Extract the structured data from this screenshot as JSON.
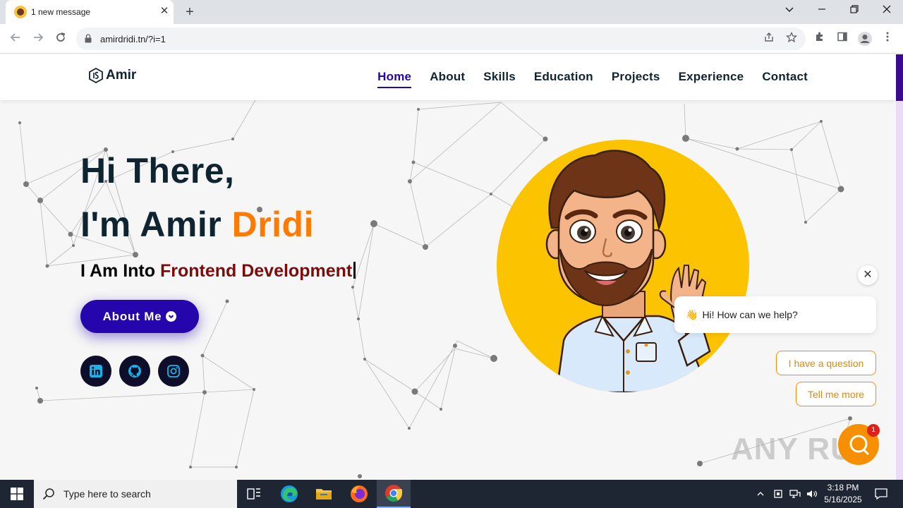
{
  "browser": {
    "tab_title": "1 new message",
    "url": "amirdridi.tn/?i=1",
    "tab_close": "✕",
    "new_tab": "+"
  },
  "site": {
    "logo_text": "Amir",
    "nav": [
      {
        "label": "Home",
        "active": true
      },
      {
        "label": "About",
        "active": false
      },
      {
        "label": "Skills",
        "active": false
      },
      {
        "label": "Education",
        "active": false
      },
      {
        "label": "Projects",
        "active": false
      },
      {
        "label": "Experience",
        "active": false
      },
      {
        "label": "Contact",
        "active": false
      }
    ],
    "hero": {
      "line1": "Hi There,",
      "line2_prefix": "I'm Amir ",
      "line2_highlight": "Dridi",
      "subtitle_prefix": "I Am Into ",
      "subtitle_highlight": "Frontend Development",
      "button_label": "About Me"
    },
    "social": [
      "linkedin-icon",
      "github-icon",
      "instagram-icon"
    ],
    "colors": {
      "primary": "#2506ad",
      "heading": "#0e2431",
      "highlight_orange": "#ff7a00",
      "highlight_red": "#7c0b0b",
      "avatar_bg": "#fcc400"
    }
  },
  "chat": {
    "greeting": "Hi! How can we help?",
    "options": [
      "I have a question",
      "Tell me more"
    ],
    "badge_count": "1",
    "close": "✕"
  },
  "watermark": "ANY RUN",
  "taskbar": {
    "search_placeholder": "Type here to search",
    "time": "3:18 PM",
    "date": "5/16/2025"
  }
}
